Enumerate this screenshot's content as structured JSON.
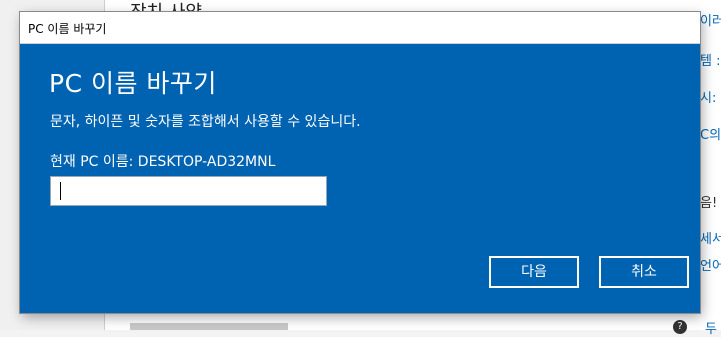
{
  "background_window": {
    "heading": "장치 사양",
    "right_links": [
      "이러 데",
      "템 :",
      "시:",
      "C의",
      "음!",
      "세서",
      "언어",
      "두"
    ]
  },
  "dialog": {
    "window_title": "PC 이름 바꾸기",
    "heading": "PC 이름 바꾸기",
    "description": "문자, 하이픈 및 숫자를 조합해서 사용할 수 있습니다.",
    "current_name_label": "현재 PC 이름: DESKTOP-AD32MNL",
    "name_input": {
      "value": "",
      "placeholder": ""
    },
    "buttons": {
      "next_label": "다음",
      "cancel_label": "취소"
    }
  },
  "colors": {
    "dialog_background": "#0063b1",
    "text": "#ffffff",
    "link": "#0067b8"
  }
}
